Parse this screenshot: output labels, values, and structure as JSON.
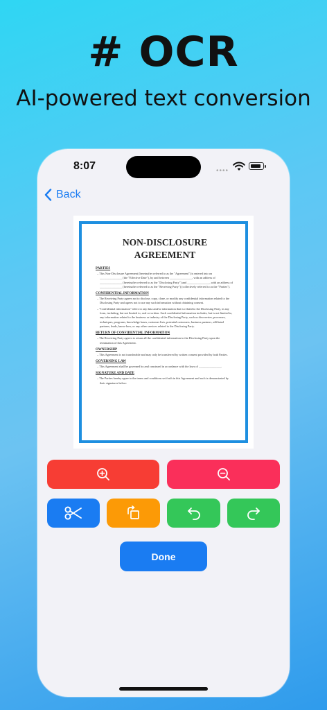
{
  "promo": {
    "headline": "# OCR",
    "subline": "AI-powered text conversion"
  },
  "status_bar": {
    "time": "8:07",
    "signal_dots": "••••",
    "icons": [
      "signal-icon",
      "wifi-icon",
      "battery-icon"
    ]
  },
  "nav": {
    "back_label": "Back",
    "back_icon": "chevron-left-icon"
  },
  "document": {
    "title_line1": "NON-DISCLOSURE",
    "title_line2": "AGREEMENT",
    "sections": [
      {
        "heading": "PARTIES",
        "paras": [
          "– This Non-Disclosure Agreement (hereinafter referred to as the \"Agreement\") is entered into on _______________ (the \"Effective Date\"), by and between _______________, with an address of _______________ (hereinafter referred to as the \"Disclosing Party\") and _______________, with an address of _______________ (hereinafter referred to as the \"Receiving Party\") (collectively referred to as the \"Parties\")."
        ]
      },
      {
        "heading": "CONFIDENTIAL INFORMATION",
        "paras": [
          "– The Receiving Party agrees not to disclose, copy, clone, or modify any confidential information related to the Disclosing Party and agrees not to use any such information without obtaining consent.",
          "– \"Confidential information\" refers to any data and/or information that is related to the Disclosing Party, in any form, including, but not limited to, oral or written. Such confidential information includes, but is not limited to, any information related to the business or industry of the Disclosing Party, such as discoveries, processes, techniques, programs, knowledge bases, customer lists, potential customers, business partners, affiliated partners, leads, know-how, or any other services related to the Disclosing Party."
        ]
      },
      {
        "heading": "RETURN OF CONFIDENTIAL INFORMATION",
        "paras": [
          "– The Receiving Party agrees to return all the confidential information to the Disclosing Party upon the termination of this Agreement."
        ]
      },
      {
        "heading": "OWNERSHIP",
        "paras": [
          "– This Agreement is not transferable and may only be transferred by written consent provided by both Parties."
        ]
      },
      {
        "heading": "GOVERNING LAW",
        "paras": [
          "– This Agreement shall be governed by and construed in accordance with the laws of _______________."
        ]
      },
      {
        "heading": "SIGNATURE AND DATE",
        "paras": [
          "– The Parties hereby agree to the terms and conditions set forth in this Agreement and such is demonstrated by their signatures below:"
        ]
      }
    ]
  },
  "toolbar": {
    "zoom_in_icon": "zoom-in-icon",
    "zoom_out_icon": "zoom-out-icon",
    "crop_icon": "scissors-icon",
    "rotate_icon": "rotate-icon",
    "undo_icon": "undo-icon",
    "redo_icon": "redo-icon",
    "done_label": "Done"
  },
  "colors": {
    "accent_blue": "#1a7cf2",
    "zoom_in_red": "#f73d34",
    "zoom_out_pink": "#fa2f5a",
    "rotate_orange": "#fc9a06",
    "green": "#34c759",
    "doc_border": "#1e8fe0"
  }
}
